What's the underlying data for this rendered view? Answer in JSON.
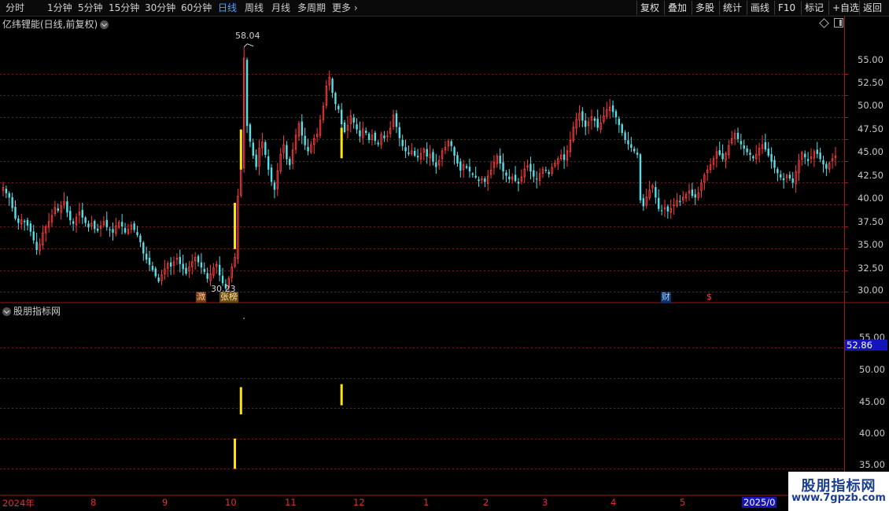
{
  "toolbar": {
    "periods": [
      "分时",
      "1分钟",
      "5分钟",
      "15分钟",
      "30分钟",
      "60分钟",
      "日线",
      "周线",
      "月线",
      "多周期",
      "更多"
    ],
    "active_period": "日线",
    "right_buttons": [
      "复权",
      "叠加",
      "多股",
      "统计",
      "画线",
      "F10",
      "标记",
      "+自选",
      "返回"
    ]
  },
  "main_panel": {
    "title": "亿纬锂能(日线,前复权)",
    "high_label": "58.04",
    "low_label": "30.23",
    "y_ticks": [
      "55.00",
      "52.50",
      "50.00",
      "47.50",
      "45.00",
      "42.50",
      "40.00",
      "37.50",
      "35.00",
      "32.50",
      "30.00"
    ],
    "y_tick_values": [
      55,
      52.5,
      50,
      47.5,
      45,
      42.5,
      40,
      37.5,
      35,
      32.5,
      30
    ],
    "event_tags": [
      {
        "label": "溦",
        "color": "#e08030"
      },
      {
        "label": "张榜",
        "color": "#e0a030"
      },
      {
        "label": "财",
        "color": "#4ea3ff"
      },
      {
        "label": "$",
        "color": "#e03030"
      }
    ]
  },
  "sub_panel": {
    "title": "股朋指标网",
    "y_ticks": [
      "55.00",
      "50.00",
      "45.00",
      "40.00",
      "35.00"
    ],
    "y_tick_values": [
      55,
      50,
      45,
      40,
      35
    ],
    "current_value": "52.86"
  },
  "x_axis": {
    "labels": [
      "2024年",
      "8",
      "9",
      "10",
      "11",
      "12",
      "1",
      "2",
      "3",
      "4",
      "5",
      "2025/0"
    ]
  },
  "watermark": {
    "main": "股朋指标网",
    "url": "www.7gpzb.com"
  },
  "colors": {
    "up": "#ff3a3a",
    "down": "#54e0e8",
    "signal": "#ffe600",
    "grid": "#7a1a1a",
    "accent": "#4ea3ff"
  },
  "chart_data": {
    "type": "candlestick",
    "closes": [
      42.0,
      41.3,
      40.8,
      39.6,
      38.4,
      37.9,
      38.3,
      38.0,
      37.6,
      36.9,
      35.9,
      34.8,
      35.5,
      36.8,
      37.5,
      38.1,
      38.8,
      39.7,
      39.3,
      39.9,
      40.4,
      39.1,
      38.2,
      37.8,
      38.6,
      39.2,
      38.5,
      37.9,
      37.4,
      37.9,
      37.2,
      37.0,
      37.6,
      38.1,
      37.4,
      37.1,
      36.8,
      37.6,
      38.0,
      37.5,
      36.8,
      37.2,
      37.7,
      37.1,
      36.5,
      35.7,
      34.4,
      33.7,
      33.1,
      32.5,
      31.8,
      31.2,
      32.0,
      32.7,
      33.3,
      32.9,
      33.5,
      33.9,
      33.2,
      32.6,
      32.1,
      32.9,
      33.5,
      34.0,
      33.4,
      32.8,
      32.3,
      31.5,
      32.1,
      32.8,
      33.2,
      31.9,
      31.0,
      30.4,
      31.6,
      32.9,
      34.0,
      41.0,
      44.2,
      56.8,
      49.0,
      47.2,
      45.6,
      44.3,
      46.5,
      47.2,
      45.7,
      44.0,
      42.6,
      41.7,
      43.9,
      45.8,
      46.9,
      45.2,
      44.5,
      46.3,
      48.0,
      49.3,
      47.9,
      46.8,
      46.1,
      46.9,
      47.6,
      48.1,
      49.7,
      51.3,
      53.6,
      54.6,
      52.8,
      51.5,
      50.9,
      49.2,
      48.3,
      49.1,
      50.2,
      49.4,
      48.6,
      47.8,
      48.7,
      48.2,
      47.4,
      48.0,
      47.3,
      46.9,
      48.1,
      47.6,
      47.9,
      48.8,
      50.3,
      48.9,
      47.6,
      46.7,
      46.1,
      45.8,
      46.2,
      45.6,
      45.4,
      45.9,
      46.4,
      45.5,
      45.8,
      44.9,
      44.3,
      45.1,
      46.2,
      46.6,
      47.3,
      46.7,
      45.6,
      44.7,
      43.9,
      44.6,
      44.2,
      43.8,
      43.4,
      43.1,
      42.7,
      43.0,
      42.6,
      43.3,
      44.0,
      44.9,
      45.6,
      44.7,
      43.8,
      43.3,
      42.9,
      43.2,
      42.7,
      42.4,
      43.2,
      44.1,
      44.5,
      43.8,
      43.2,
      42.9,
      43.6,
      44.1,
      43.9,
      43.5,
      44.3,
      44.8,
      45.3,
      45.7,
      45.1,
      46.2,
      47.4,
      48.9,
      49.8,
      50.5,
      49.6,
      48.9,
      49.5,
      50.1,
      49.6,
      48.8,
      49.4,
      50.2,
      50.9,
      51.2,
      50.6,
      50.0,
      49.1,
      48.2,
      47.4,
      46.9,
      46.5,
      46.1,
      45.7,
      40.5,
      39.8,
      40.9,
      41.7,
      42.2,
      40.8,
      39.5,
      39.3,
      39.7,
      39.2,
      39.6,
      40.0,
      40.5,
      40.3,
      40.9,
      41.2,
      41.6,
      41.0,
      40.8,
      41.4,
      42.5,
      43.4,
      44.0,
      44.6,
      45.3,
      46.1,
      45.7,
      45.2,
      45.9,
      46.8,
      47.6,
      48.2,
      47.5,
      46.9,
      46.4,
      46.0,
      45.7,
      45.3,
      45.8,
      46.5,
      46.9,
      46.3,
      45.6,
      44.9,
      44.2,
      43.6,
      43.1,
      42.8,
      43.4,
      43.0,
      42.5,
      43.8,
      45.1,
      46.0,
      45.4,
      45.0,
      45.5,
      46.1,
      45.8,
      45.2,
      44.6,
      44.1,
      44.8,
      45.3,
      45.6
    ],
    "signals_main": [
      [
        76,
        34.9,
        40.2
      ],
      [
        78,
        44.0,
        48.6
      ],
      [
        111,
        45.3,
        48.8
      ]
    ],
    "signals_sub": [
      [
        76,
        35.0,
        40.0
      ],
      [
        78,
        44.0,
        48.5
      ],
      [
        111,
        45.5,
        49.0
      ]
    ],
    "main_ylim": [
      29.4,
      60.0
    ],
    "sub_ylim": [
      33.5,
      60.5
    ],
    "ylabel": ""
  }
}
